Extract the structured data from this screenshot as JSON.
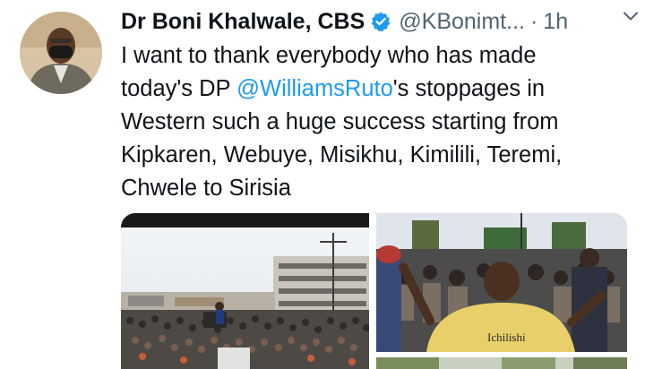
{
  "author": {
    "name": "Dr Boni Khalwale, CBS",
    "handle": "@KBonimt...",
    "separator": "·",
    "time": "1h",
    "verified": true,
    "avatar_icon": "profile-photo"
  },
  "tweet": {
    "text_before": "I want to thank everybody who has made\ntoday's DP ",
    "mention": "@WilliamsRuto",
    "text_after": "'s stoppages in\nWestern such a huge success starting from\nKipkaren, Webuye, Misikhu, Kimilili, Teremi,\nChwele to Sirisia"
  },
  "media": {
    "photo2_shirt_text": "Ichilishi"
  },
  "colors": {
    "link": "#1d9bf0",
    "secondary_text": "#536471",
    "verified_badge": "#1d9bf0"
  },
  "icons": {
    "verified": "verified-badge-icon",
    "more": "chevron-down-icon"
  }
}
